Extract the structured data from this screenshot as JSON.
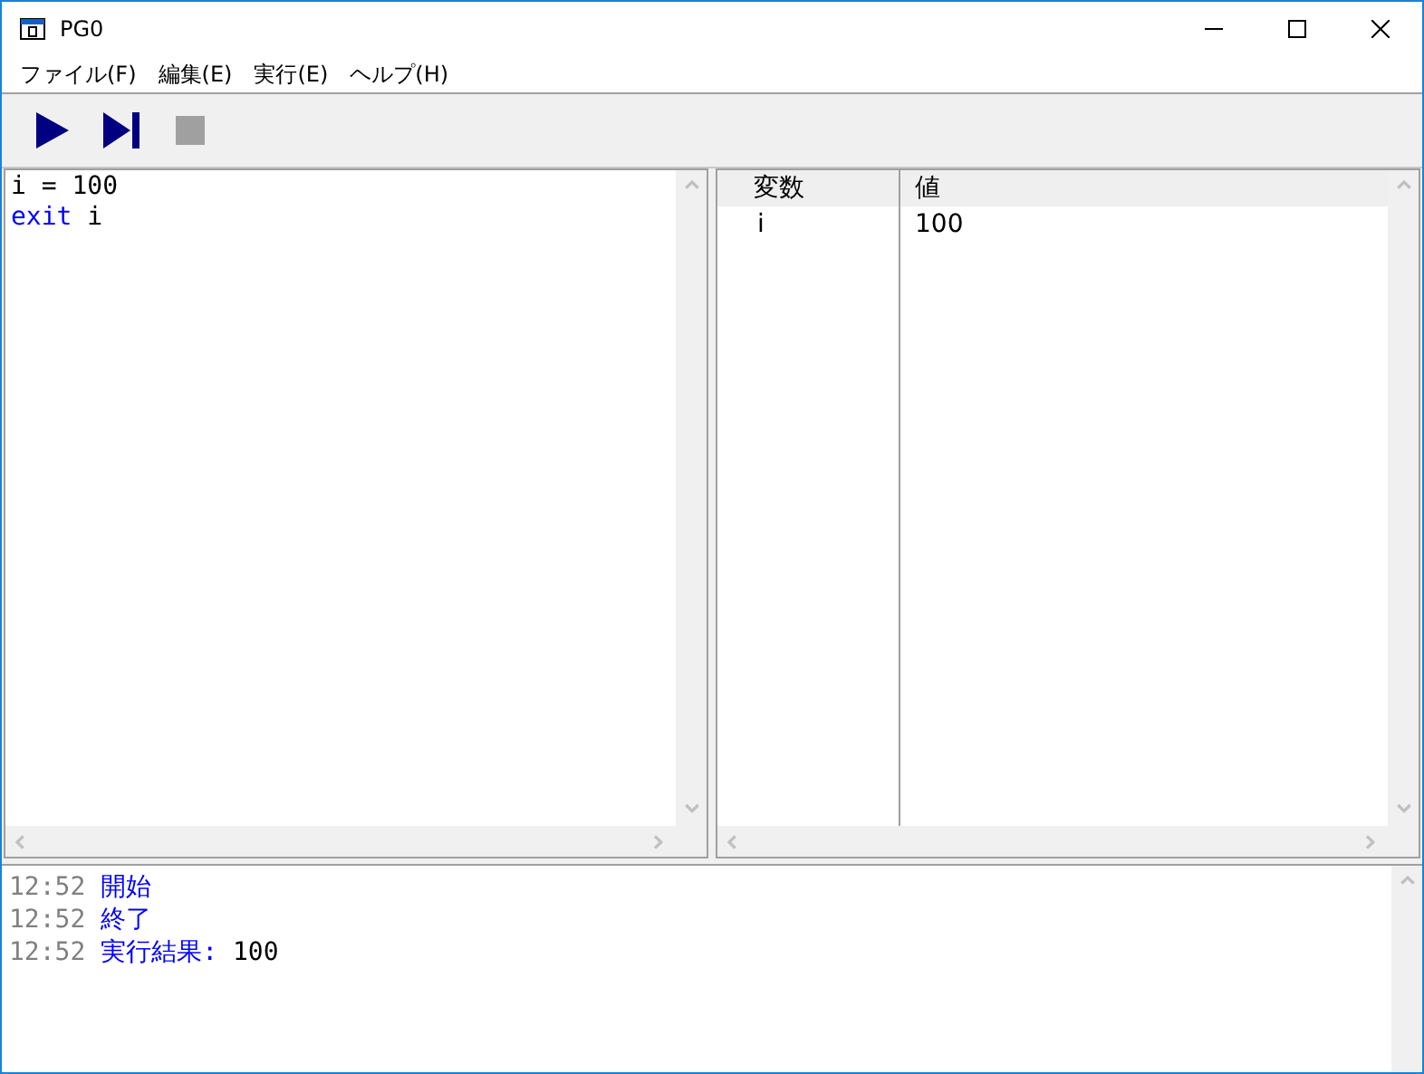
{
  "window": {
    "title": "PG0"
  },
  "menu": [
    {
      "label": "ファイル(F)"
    },
    {
      "label": "編集(E)"
    },
    {
      "label": "実行(E)"
    },
    {
      "label": "ヘルプ(H)"
    }
  ],
  "toolbar": [
    {
      "kind": "run",
      "disabled": false
    },
    {
      "kind": "step",
      "disabled": false
    },
    {
      "kind": "stop",
      "disabled": true
    }
  ],
  "editor": {
    "lines": [
      [
        {
          "kind": "plain",
          "text": "i = 100"
        }
      ],
      [
        {
          "kind": "keyword",
          "text": "exit"
        },
        {
          "kind": "plain",
          "text": " i"
        }
      ]
    ]
  },
  "variables": {
    "columns": [
      "変数",
      "値"
    ],
    "rows": [
      [
        "i",
        "100"
      ]
    ]
  },
  "log": [
    {
      "time": "12:52",
      "message": "開始"
    },
    {
      "time": "12:52",
      "message": "終了"
    },
    {
      "time": "12:52",
      "message": "実行結果:",
      "value": "100"
    }
  ]
}
